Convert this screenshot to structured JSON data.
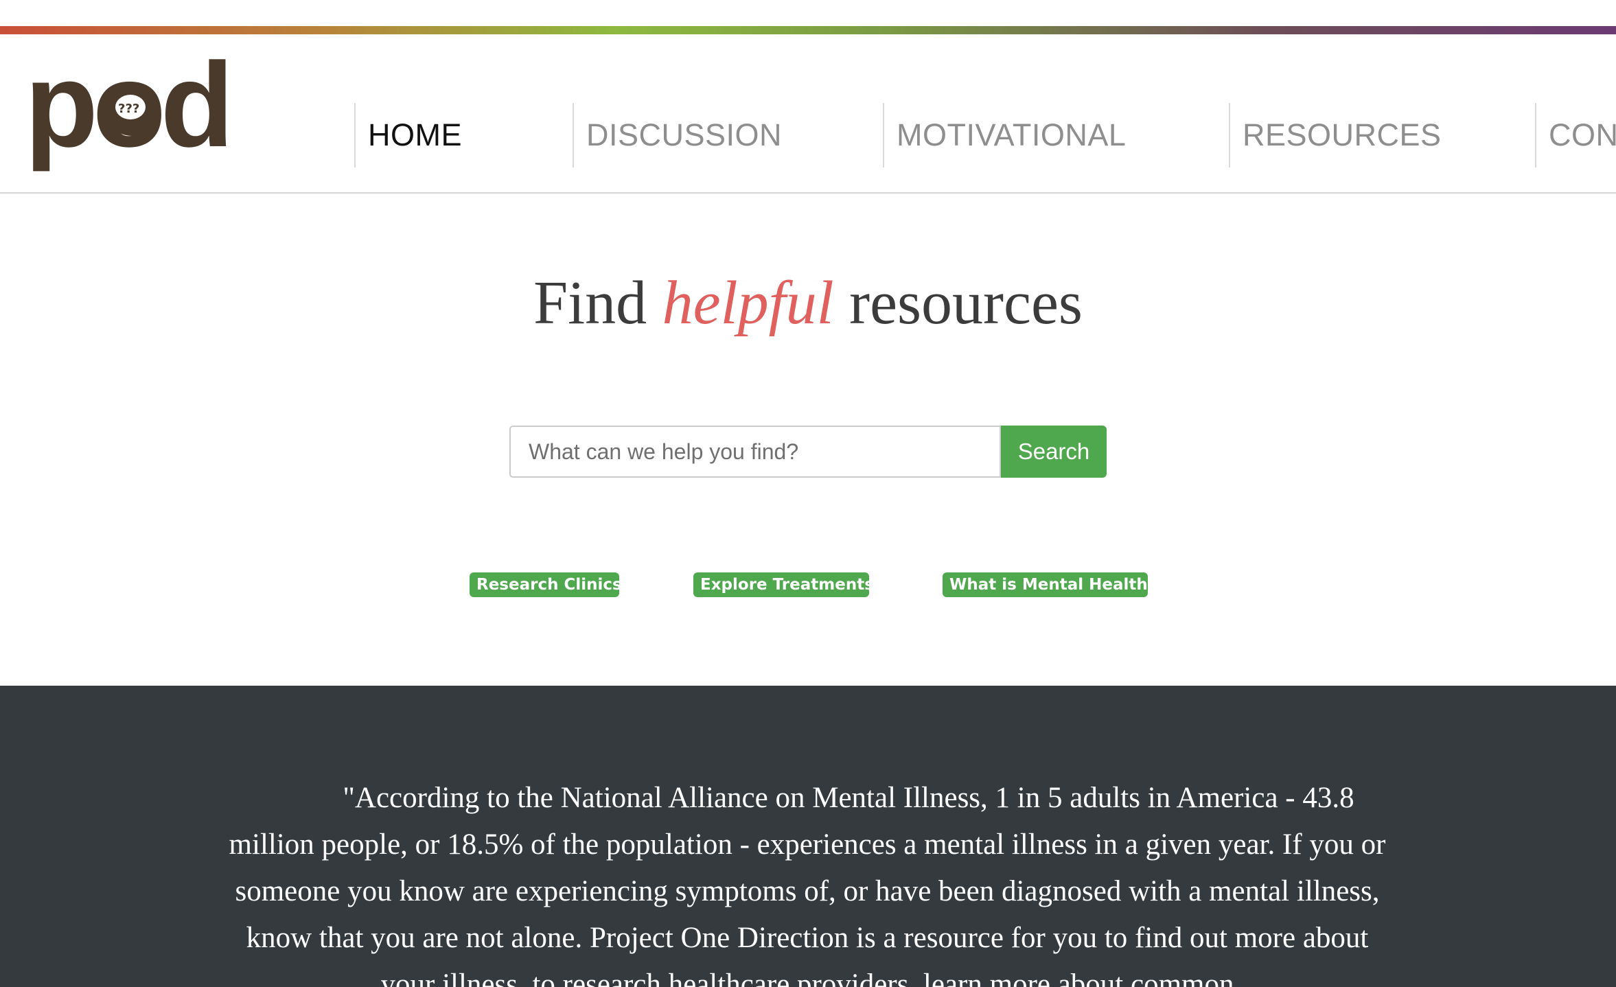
{
  "nav": {
    "items": [
      {
        "label": "HOME",
        "active": true
      },
      {
        "label": "DISCUSSION",
        "active": false
      },
      {
        "label": "MOTIVATIONAL",
        "active": false
      },
      {
        "label": "RESOURCES",
        "active": false
      },
      {
        "label": "CONT",
        "active": false
      }
    ]
  },
  "logo": {
    "text": "pod",
    "brain_marks": "???",
    "color": "#4a3a2c"
  },
  "hero": {
    "title_before": "Find",
    "title_accent": "helpful",
    "title_after": "resources",
    "accent_color": "#e0605e"
  },
  "search": {
    "placeholder": "What can we help you find?",
    "value": "",
    "button_label": "Search",
    "button_color": "#4fa84e"
  },
  "quick_links": [
    {
      "label": "Research Clinics"
    },
    {
      "label": "Explore Treatments"
    },
    {
      "label": "What is Mental Health?"
    }
  ],
  "quote": {
    "text": "\"According to the National Alliance on Mental Illness, 1 in 5 adults in America - 43.8 million people, or 18.5% of the population - experiences a mental illness in a given year. If you or someone you know are experiencing symptoms of, or have been diagnosed with a mental illness, know that you are not alone. Project One Direction is a resource for you to find out more about your illness, to research healthcare providers, learn more about common"
  },
  "colors": {
    "dark_section": "#353a3e",
    "top_bar_start": "#c94f38",
    "top_bar_mid": "#8db93f",
    "top_bar_end": "#6b3a73"
  }
}
